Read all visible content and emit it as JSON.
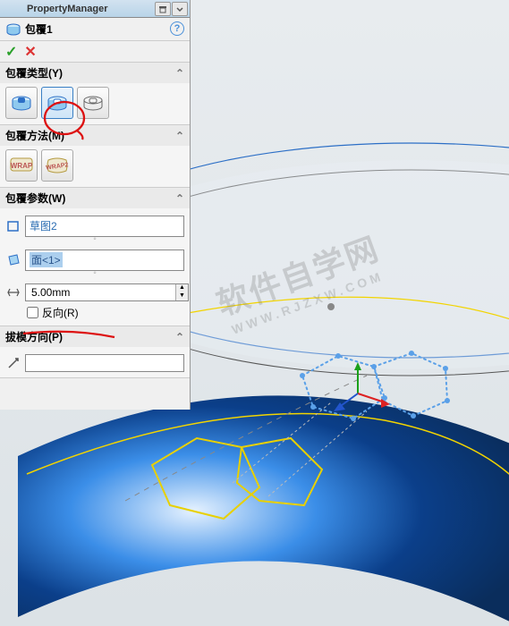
{
  "header": {
    "title": "PropertyManager"
  },
  "feature": {
    "name": "包覆1",
    "help_symbol": "?"
  },
  "actions": {
    "ok_symbol": "✓",
    "cancel_symbol": "✕"
  },
  "sections": {
    "type": {
      "label": "包覆类型(Y)",
      "buttons": [
        "emboss",
        "deboss",
        "scribe"
      ],
      "selected_index": 1
    },
    "method": {
      "label": "包覆方法(M)",
      "buttons": [
        "WRAP",
        "WRAP2"
      ]
    },
    "params": {
      "label": "包覆参数(W)",
      "sketch_value": "草图2",
      "face_value": "面<1>",
      "thickness": "5.00mm",
      "reverse_label": "反向(R)",
      "reverse_checked": false
    },
    "draft": {
      "label": "拔模方向(P)",
      "value": ""
    }
  },
  "watermark": {
    "line1": "软件自学网",
    "line2": "WWW.RJZXW.COM"
  },
  "chevron": "⌃"
}
